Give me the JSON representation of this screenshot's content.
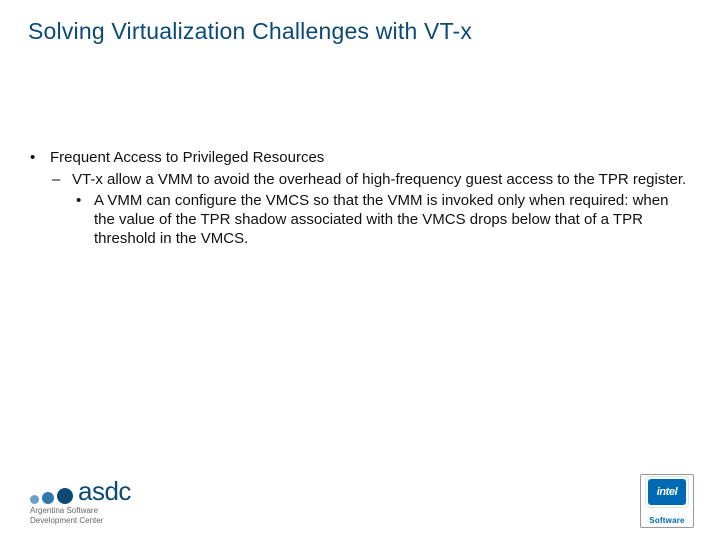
{
  "title": "Solving Virtualization Challenges with VT-x",
  "bullets": {
    "lvl1": "Frequent Access to Privileged Resources",
    "lvl2": "VT-x allow a VMM to avoid the overhead of high-frequency guest access to the TPR register.",
    "lvl3": "A VMM can configure the VMCS so that the VMM is invoked only when required: when the value of the TPR shadow associated with the VMCS drops below that of a TPR threshold in the VMCS."
  },
  "footer": {
    "asdc_wordmark": "asdc",
    "asdc_line1": "Argentina Software",
    "asdc_line2": "Development Center",
    "intel_brand": "intel",
    "intel_label": "Software"
  }
}
